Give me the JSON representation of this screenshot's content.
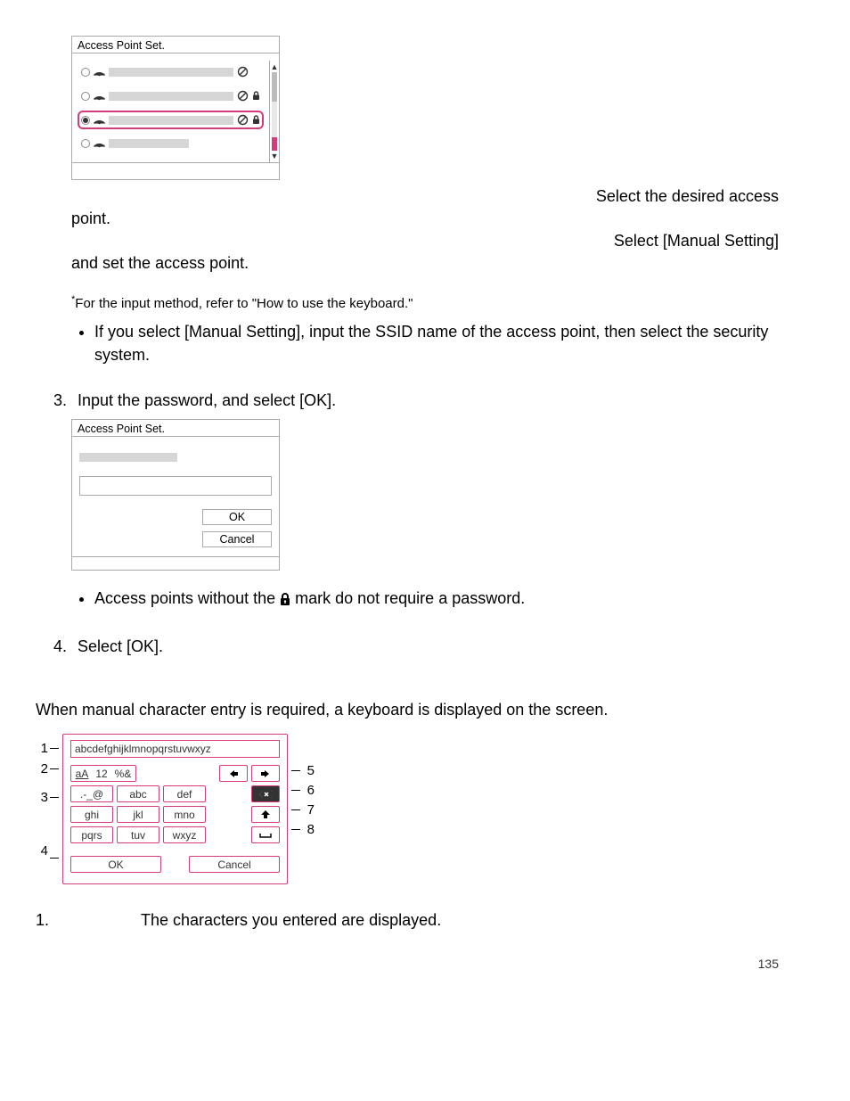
{
  "ap_box": {
    "title": "Access Point Set."
  },
  "text": {
    "sel_desired_r": "Select the desired access",
    "point": "point.",
    "sel_manual_r": "Select [Manual Setting]",
    "and_set": "and set the access point.",
    "footnote_star": "*",
    "footnote": "For the input method, refer to \"How to use the keyboard.\"",
    "bullet_manual": "If you select [Manual Setting], input the SSID name of the access point, then select the security system.",
    "step3_num": "3.",
    "step3": "Input the password, and select [OK].",
    "bullet_nolock_a": "Access points without the ",
    "bullet_nolock_b": " mark do not require a password.",
    "step4_num": "4.",
    "step4": "Select [OK].",
    "kb_intro": "When manual character entry is required, a keyboard is displayed on the screen."
  },
  "pw_box": {
    "title": "Access Point Set.",
    "ok": "OK",
    "cancel": "Cancel"
  },
  "keyboard": {
    "left_labels": [
      "1",
      "2",
      "3",
      "4"
    ],
    "right_labels": [
      "5",
      "6",
      "7",
      "8"
    ],
    "input_text": "abcdefghijklmnopqrstuvwxyz",
    "mode_aA": "aA",
    "mode_12": "12",
    "mode_sym": "%&",
    "keys_r1": [
      ".-_@",
      "abc",
      "def"
    ],
    "keys_r2": [
      "ghi",
      "jkl",
      "mno"
    ],
    "keys_r3": [
      "pqrs",
      "tuv",
      "wxyz"
    ],
    "ok": "OK",
    "cancel": "Cancel"
  },
  "legend": {
    "items": [
      {
        "num": "1.",
        "text": "The characters you entered are displayed."
      }
    ]
  },
  "page_number": "135"
}
